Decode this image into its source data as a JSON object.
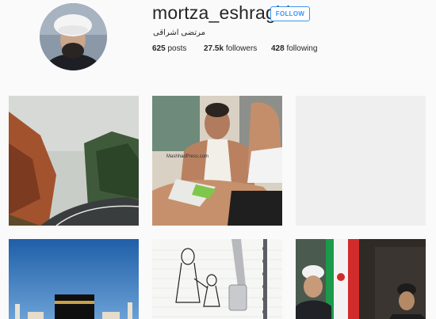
{
  "profile": {
    "username": "mortza_eshraghi",
    "follow_label": "FOLLOW",
    "full_name": "مرتضی اشراقی",
    "stats": [
      {
        "count": "625",
        "label": "posts"
      },
      {
        "count": "27.5k",
        "label": "followers"
      },
      {
        "count": "428",
        "label": "following"
      }
    ]
  },
  "posts": [
    {
      "name": "post-foggy-road",
      "text": ""
    },
    {
      "name": "post-man-photo",
      "text": "MashhadPress.com"
    },
    {
      "name": "post-empty-placeholder",
      "text": ""
    },
    {
      "name": "post-kaaba",
      "text": ""
    },
    {
      "name": "post-notebook-drawing",
      "text": ""
    },
    {
      "name": "post-cleric-flag",
      "text": ""
    }
  ],
  "colors": {
    "accent": "#3897f0",
    "text": "#262626",
    "background": "#fafafa"
  }
}
